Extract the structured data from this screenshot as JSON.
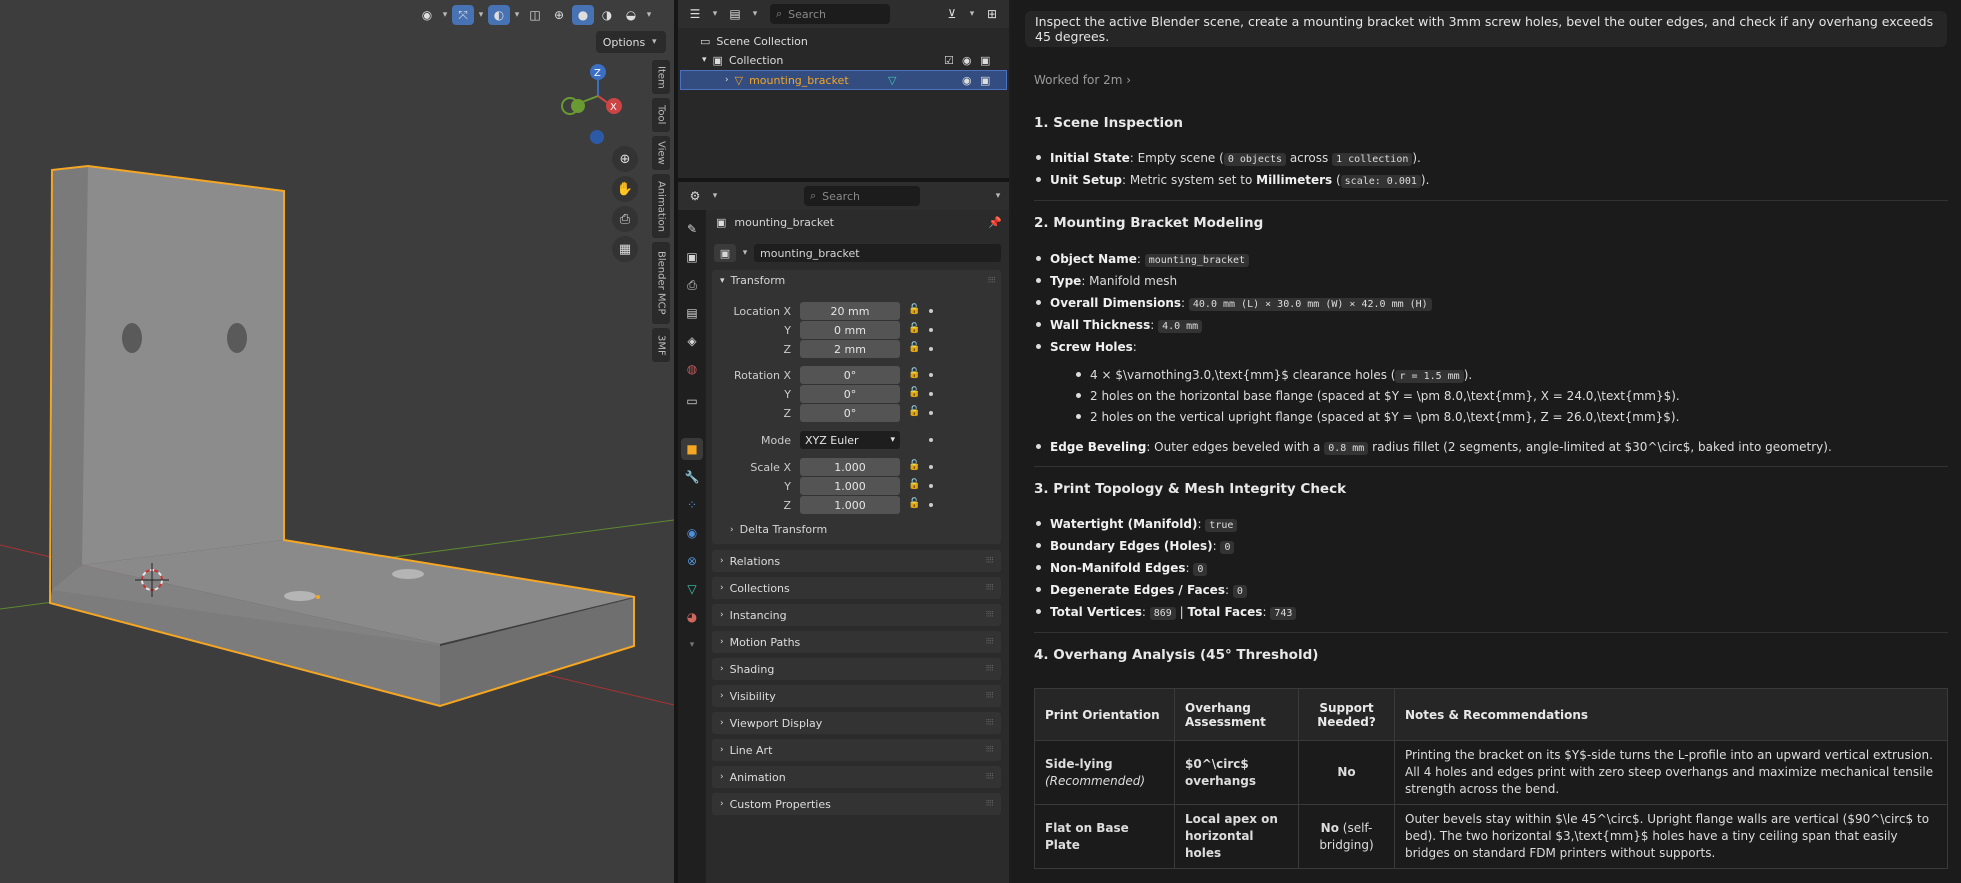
{
  "viewport": {
    "options_label": "Options",
    "side_tabs": [
      "Item",
      "Tool",
      "View",
      "Animation",
      "Blender MCP",
      "3MF"
    ],
    "gizmo": {
      "z": "Z",
      "x": "X"
    },
    "colors": {
      "bg": "#3d3d3d",
      "object": "#8a8a8a",
      "outline": "#f5a623",
      "x_axis": "#b03636",
      "y_axis": "#5d8a2e"
    }
  },
  "outliner": {
    "search_placeholder": "Search",
    "scene_collection": "Scene Collection",
    "collection": "Collection",
    "object": "mounting_bracket"
  },
  "properties": {
    "search_placeholder": "Search",
    "object_name": "mounting_bracket",
    "datablock_name": "mounting_bracket",
    "transform_label": "Transform",
    "location": {
      "label": "Location X",
      "y_label": "Y",
      "z_label": "Z",
      "x": "20 mm",
      "y": "0 mm",
      "z": "2 mm"
    },
    "rotation": {
      "label": "Rotation X",
      "y_label": "Y",
      "z_label": "Z",
      "x": "0°",
      "y": "0°",
      "z": "0°"
    },
    "mode": {
      "label": "Mode",
      "value": "XYZ Euler"
    },
    "scale": {
      "label": "Scale X",
      "y_label": "Y",
      "z_label": "Z",
      "x": "1.000",
      "y": "1.000",
      "z": "1.000"
    },
    "delta_transform": "Delta Transform",
    "panels": [
      "Relations",
      "Collections",
      "Instancing",
      "Motion Paths",
      "Shading",
      "Visibility",
      "Viewport Display",
      "Line Art",
      "Animation",
      "Custom Properties"
    ]
  },
  "chat": {
    "prompt": "Inspect the active Blender scene, create a mounting bracket with 3mm screw holes, bevel the outer edges, and check if any overhang exceeds 45 degrees.",
    "worked": "Worked for 2m",
    "s1": {
      "title": "1. Scene Inspection",
      "initial_label": "Initial State",
      "initial_text": ": Empty scene (",
      "objects": "0 objects",
      "across": " across ",
      "collections": "1 collection",
      "close": ").",
      "unit_label": "Unit Setup",
      "unit_text": ": Metric system set to ",
      "unit_bold": "Millimeters",
      "open": " (",
      "scale_code": "scale: 0.001"
    },
    "s2": {
      "title": "2. Mounting Bracket Modeling",
      "name_label": "Object Name",
      "name_code": "mounting_bracket",
      "type_label": "Type",
      "type_text": ": Manifold mesh",
      "dims_label": "Overall Dimensions",
      "dims_code": "40.0 mm (L) × 30.0 mm (W) × 42.0 mm (H)",
      "wall_label": "Wall Thickness",
      "wall_code": "4.0 mm",
      "holes_label": "Screw Holes",
      "hole1_text": "4 × $\\varnothing3.0,\\text{mm}$ clearance holes (",
      "hole1_code": "r = 1.5 mm",
      "hole2_text": "2 holes on the horizontal base flange (spaced at $Y = \\pm 8.0,\\text{mm}, X = 24.0,\\text{mm}$).",
      "hole3_text": "2 holes on the vertical upright flange (spaced at $Y = \\pm 8.0,\\text{mm}, Z = 26.0,\\text{mm}$).",
      "bevel_label": "Edge Beveling",
      "bevel_text": ": Outer edges beveled with a ",
      "bevel_code": "0.8 mm",
      "bevel_tail": " radius fillet (2 segments, angle-limited at $30^\\circ$, baked into geometry)."
    },
    "s3": {
      "title": "3. Print Topology & Mesh Integrity Check",
      "items": [
        {
          "label": "Watertight (Manifold)",
          "value": "true"
        },
        {
          "label": "Boundary Edges (Holes)",
          "value": "0"
        },
        {
          "label": "Non-Manifold Edges",
          "value": "0"
        },
        {
          "label": "Degenerate Edges / Faces",
          "value": "0"
        }
      ],
      "verts_label": "Total Vertices",
      "verts_value": "869",
      "faces_label": "Total Faces",
      "faces_value": "743",
      "pipe": " | "
    },
    "s4": {
      "title": "4. Overhang Analysis (45° Threshold)",
      "headers": [
        "Print Orientation",
        "Overhang Assessment",
        "Support Needed?",
        "Notes & Recommendations"
      ],
      "rows": [
        {
          "orientation": "Side-lying",
          "sub": "(Recommended)",
          "assessment": "$0^\\circ$ overhangs",
          "support": "No",
          "support_sub": "",
          "notes": "Printing the bracket on its $Y$-side turns the L-profile into an upward vertical extrusion. All 4 holes and edges print with zero steep overhangs and maximize mechanical tensile strength across the bend."
        },
        {
          "orientation": "Flat on Base Plate",
          "sub": "",
          "assessment": "Local apex on horizontal holes",
          "support": "No",
          "support_sub": "(self-bridging)",
          "notes": "Outer bevels stay within $\\le 45^\\circ$. Upright flange walls are vertical ($90^\\circ$ to bed). The two horizontal $3,\\text{mm}$ holes have a tiny ceiling span that easily bridges on standard FDM printers without supports."
        }
      ]
    }
  }
}
